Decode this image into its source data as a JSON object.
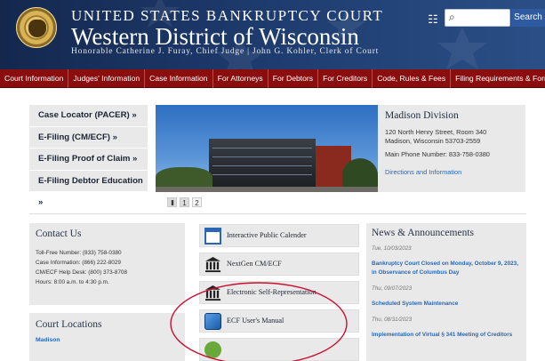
{
  "header": {
    "line1": "UNITED STATES BANKRUPTCY COURT",
    "line2": "Western District of Wisconsin",
    "line3": "Honorable Catherine J. Furay, Chief Judge | John G. Kohler, Clerk of Court",
    "search_placeholder": "",
    "search_button": "Search",
    "translate_icon": "translate-icon",
    "search_icon": "magnifier-icon"
  },
  "nav": [
    "Court Information",
    "Judges' Information",
    "Case Information",
    "For Attorneys",
    "For Debtors",
    "For Creditors",
    "Code, Rules & Fees",
    "Filing Requirements & Forms"
  ],
  "quick_links": [
    "Case Locator (PACER) »",
    "E-Filing (CM/ECF) »",
    "E-Filing Proof of Claim »",
    "E-Filing Debtor Education »"
  ],
  "slider": {
    "pause": "II",
    "pages": [
      "1",
      "2"
    ]
  },
  "division": {
    "title": "Madison Division",
    "address1": "120 North Henry Street, Room 340",
    "address2": "Madison, Wisconsin 53703-2559",
    "phone": "Main Phone Number: 833-758-0380",
    "link": "Directions and Information"
  },
  "contact": {
    "title": "Contact Us",
    "lines": [
      "Toll-Free Number: (833) 758-0380",
      "Case Information: (866) 222-8029",
      "CM/ECF Help Desk: (800) 373-8708",
      "Hours: 8:00 a.m. to 4:30 p.m."
    ]
  },
  "locations": {
    "title": "Court Locations",
    "first": "Madison"
  },
  "middle_links": [
    {
      "label": "Interactive Public Calender",
      "icon": "calendar-icon"
    },
    {
      "label": "NextGen CM/ECF",
      "icon": "courthouse-icon"
    },
    {
      "label": "Electronic Self-Representation",
      "icon": "courthouse-icon"
    },
    {
      "label": "ECF User's Manual",
      "icon": "manual-book-icon"
    },
    {
      "label": "",
      "icon": "green-globe-icon"
    }
  ],
  "news": {
    "title": "News & Announcements",
    "items": [
      {
        "date": "Tue, 10/03/2023",
        "headline": "Bankruptcy Court Closed on Monday, October 9, 2023, in Observance of Columbus Day"
      },
      {
        "date": "Thu, 09/07/2023",
        "headline": "Scheduled System Maintenance"
      },
      {
        "date": "Thu, 08/31/2023",
        "headline": "Implementation of Virtual § 341 Meeting of Creditors"
      }
    ]
  },
  "colors": {
    "header_bg": "#1d3a6c",
    "nav_bg": "#8b0e0e",
    "link": "#2a68b8",
    "annotation": "#c8102e"
  }
}
